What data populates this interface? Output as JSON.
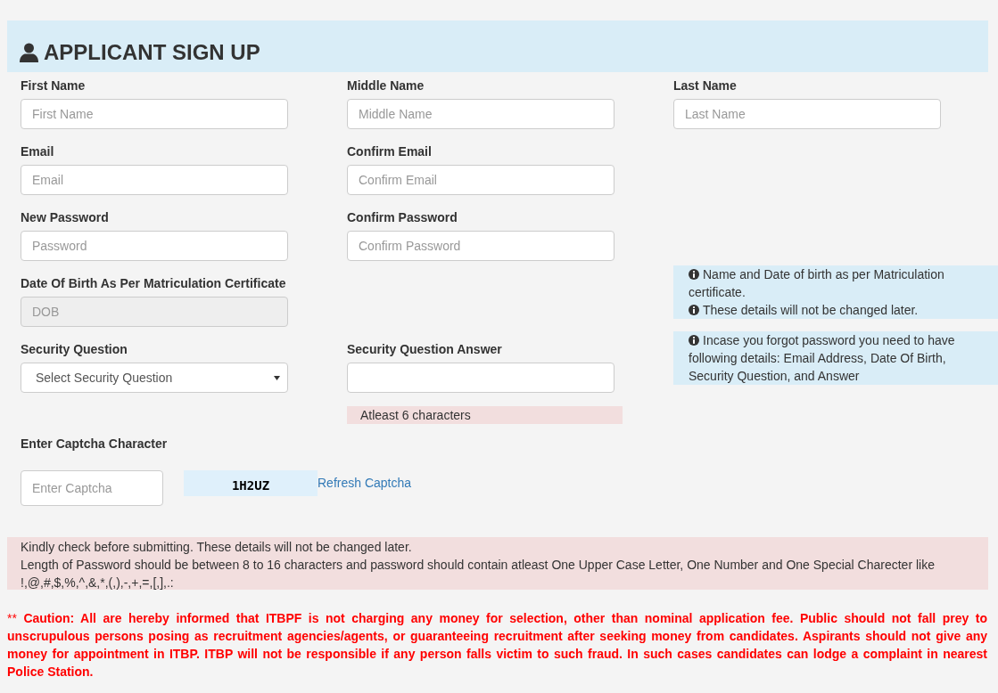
{
  "header": {
    "title": "APPLICANT SIGN UP"
  },
  "rows": [
    {
      "fields": [
        {
          "label": "First Name",
          "kind": "text",
          "placeholder": "First Name",
          "disabled": false
        },
        {
          "label": "Middle Name",
          "kind": "text",
          "placeholder": "Middle Name",
          "disabled": false
        },
        {
          "label": "Last Name",
          "kind": "text",
          "placeholder": "Last Name",
          "disabled": false
        }
      ]
    },
    {
      "fields": [
        {
          "label": "Email",
          "kind": "text",
          "placeholder": "Email",
          "disabled": false
        },
        {
          "label": "Confirm Email",
          "kind": "text",
          "placeholder": "Confirm Email",
          "disabled": false
        }
      ]
    },
    {
      "fields": [
        {
          "label": "New Password",
          "kind": "password",
          "placeholder": "Password",
          "disabled": false
        },
        {
          "label": "Confirm Password",
          "kind": "password",
          "placeholder": "Confirm Password",
          "disabled": false
        }
      ]
    },
    {
      "fields": [
        {
          "label": "Date Of Birth As Per Matriculation Certificate",
          "kind": "text",
          "placeholder": "DOB",
          "disabled": true
        }
      ],
      "note": [
        "Name and Date of birth as per Matriculation certificate.",
        "These details will not be changed later."
      ]
    },
    {
      "fields": [
        {
          "label": "Security Question",
          "kind": "select",
          "value": "Select Security Question",
          "disabled": false
        },
        {
          "label": "Security Question Answer",
          "kind": "text",
          "disabled": false,
          "hint": "Atleast 6 characters"
        }
      ],
      "note": [
        "Incase you forgot password you need to have following details: Email Address, Date Of Birth, Security Question, and Answer"
      ]
    }
  ],
  "captcha": {
    "label": "Enter Captcha Character",
    "placeholder": "Enter Captcha",
    "code": "1H2UZ",
    "refresh": "Refresh Captcha"
  },
  "notice": [
    "Kindly check before submitting. These details will not be changed later.",
    "Length of Password should be between 8 to 16 characters and password should contain atleast One Upper Case Letter, One Number and One Special Charecter like !,@,#,$,%,^,&,*,(,),-,+,=,[,],.:"
  ],
  "caution": {
    "mark": "**",
    "text": "Caution: All are hereby informed that ITBPF is not charging any money for selection, other than nominal application fee. Public should not fall prey to unscrupulous persons posing as recruitment agencies/agents, or guaranteeing recruitment after seeking money from candidates. Aspirants should not give any money for appointment in ITBP. ITBP will not be responsible if any person falls victim to such fraud. In such cases candidates can lodge a complaint in nearest Police Station."
  }
}
